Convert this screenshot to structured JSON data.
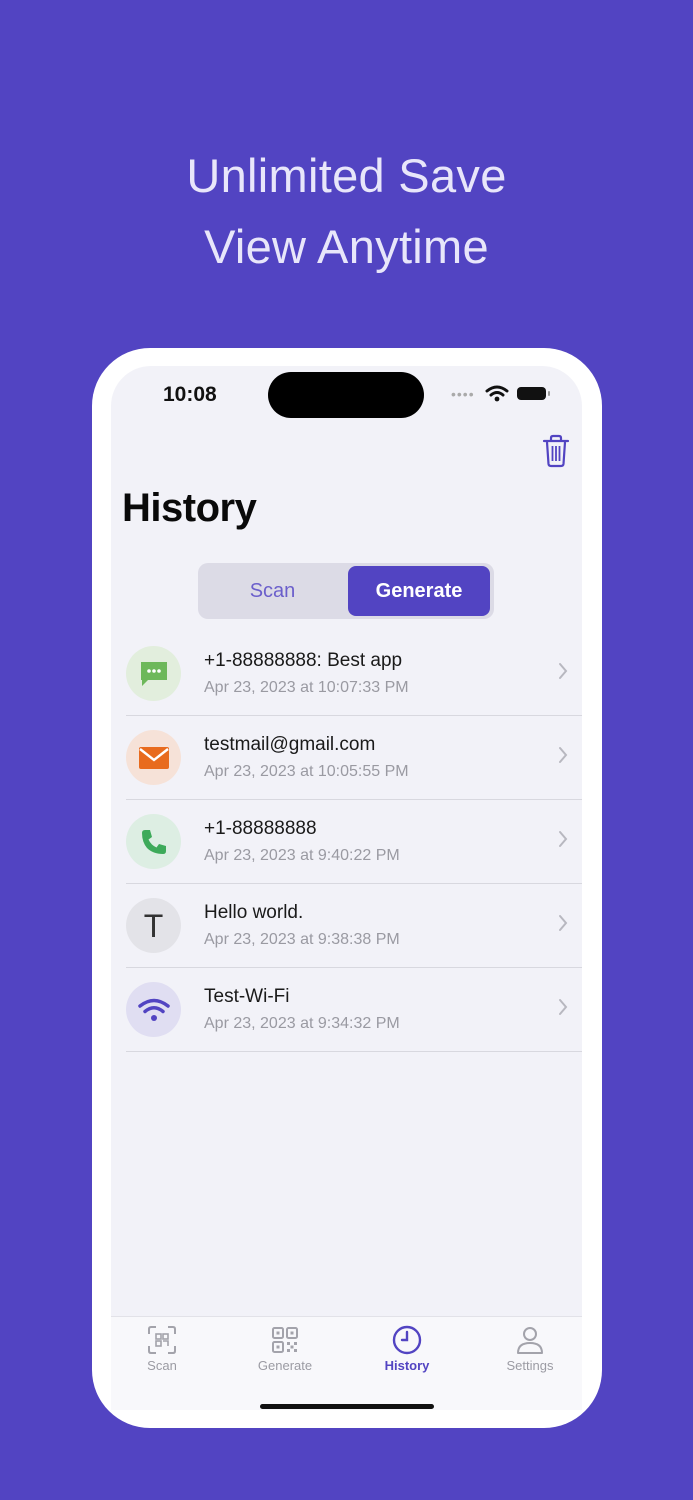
{
  "promo": {
    "line1": "Unlimited Save",
    "line2": "View Anytime"
  },
  "status_bar": {
    "time": "10:08"
  },
  "page": {
    "title": "History",
    "trash_icon": "trash-icon"
  },
  "segmented": {
    "scan_label": "Scan",
    "generate_label": "Generate",
    "selected": "Generate"
  },
  "history": [
    {
      "icon": "message-icon",
      "title": "+1-88888888: Best app",
      "date": "Apr 23, 2023 at 10:07:33 PM"
    },
    {
      "icon": "mail-icon",
      "title": "testmail@gmail.com",
      "date": "Apr 23, 2023 at 10:05:55 PM"
    },
    {
      "icon": "phone-icon",
      "title": "+1-88888888",
      "date": "Apr 23, 2023 at 9:40:22 PM"
    },
    {
      "icon": "text-icon",
      "glyph": "T",
      "title": "Hello world.",
      "date": "Apr 23, 2023 at 9:38:38 PM"
    },
    {
      "icon": "wifi-icon",
      "title": "Test-Wi-Fi",
      "date": "Apr 23, 2023 at 9:34:32 PM"
    }
  ],
  "tabbar": {
    "tabs": [
      {
        "label": "Scan",
        "icon": "scan-icon"
      },
      {
        "label": "Generate",
        "icon": "qr-code-icon"
      },
      {
        "label": "History",
        "icon": "clock-icon"
      },
      {
        "label": "Settings",
        "icon": "person-icon"
      }
    ],
    "active": "History"
  },
  "colors": {
    "background": "#5244C2",
    "accent": "#5244C2",
    "message": "#6DB85A",
    "mail": "#E86B1E",
    "phone": "#3DAA5A",
    "wifi": "#5244C2"
  }
}
